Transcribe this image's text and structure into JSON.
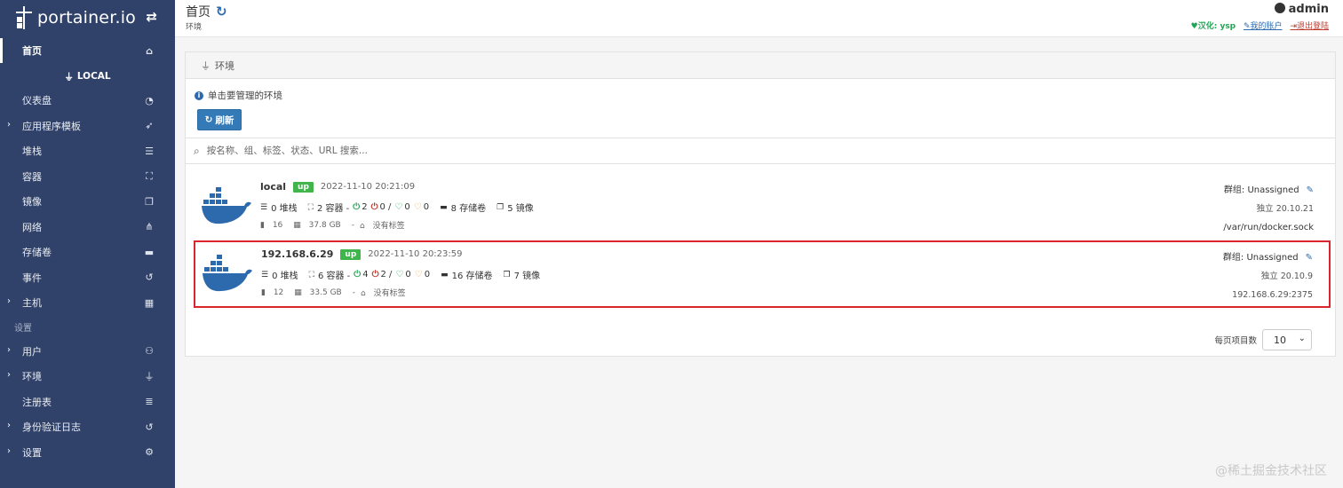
{
  "brand": {
    "name": "portainer.io",
    "toggle_icon": "exchange-icon"
  },
  "sidebar": {
    "home": {
      "label": "首页",
      "icon": "home-icon"
    },
    "env_header": "LOCAL",
    "items": [
      {
        "label": "仪表盘",
        "icon": "tachometer-icon",
        "chevron": false
      },
      {
        "label": "应用程序模板",
        "icon": "rocket-icon",
        "chevron": true
      },
      {
        "label": "堆栈",
        "icon": "th-list-icon",
        "chevron": false
      },
      {
        "label": "容器",
        "icon": "cubes-icon",
        "chevron": false
      },
      {
        "label": "镜像",
        "icon": "clone-icon",
        "chevron": false
      },
      {
        "label": "网络",
        "icon": "sitemap-icon",
        "chevron": false
      },
      {
        "label": "存储卷",
        "icon": "hdd-icon",
        "chevron": false
      },
      {
        "label": "事件",
        "icon": "history-icon",
        "chevron": false
      },
      {
        "label": "主机",
        "icon": "th-icon",
        "chevron": true
      }
    ],
    "settings_title": "设置",
    "settings_items": [
      {
        "label": "用户",
        "icon": "users-icon",
        "chevron": true
      },
      {
        "label": "环境",
        "icon": "plug-icon",
        "chevron": true
      },
      {
        "label": "注册表",
        "icon": "database-icon",
        "chevron": false
      },
      {
        "label": "身份验证日志",
        "icon": "history-icon",
        "chevron": true
      },
      {
        "label": "设置",
        "icon": "cogs-icon",
        "chevron": true
      }
    ]
  },
  "header": {
    "title": "首页",
    "breadcrumb": "环境",
    "user": "admin",
    "credit": "汉化: ysp",
    "my_account": "我的账户",
    "logout": "退出登陆"
  },
  "panel": {
    "title": "环境",
    "info": "单击要管理的环境",
    "refresh_label": "刷新",
    "search_placeholder": "按名称、组、标签、状态、URL 搜索..."
  },
  "environments": [
    {
      "name": "local",
      "status": "up",
      "time": "2022-11-10 20:21:09",
      "stacks": "0 堆栈",
      "containers": "2 容器 -",
      "running": "2",
      "stopped": "0 /",
      "healthy": "0",
      "unhealthy": "0",
      "volumes": "8 存储卷",
      "images": "5 镜像",
      "cpu": "16",
      "memory": "37.8 GB",
      "sep": "-",
      "tags": "没有标签",
      "group": "群组: Unassigned",
      "version": "独立 20.10.21",
      "url": "/var/run/docker.sock"
    },
    {
      "name": "192.168.6.29",
      "status": "up",
      "time": "2022-11-10 20:23:59",
      "stacks": "0 堆栈",
      "containers": "6 容器 -",
      "running": "4",
      "stopped": "2 /",
      "healthy": "0",
      "unhealthy": "0",
      "volumes": "16 存储卷",
      "images": "7 镜像",
      "cpu": "12",
      "memory": "33.5 GB",
      "sep": "-",
      "tags": "没有标签",
      "group": "群组: Unassigned",
      "version": "独立 20.10.9",
      "url": "192.168.6.29:2375"
    }
  ],
  "pagination": {
    "label": "每页项目数",
    "value": "10"
  },
  "watermark": "@稀土掘金技术社区",
  "colors": {
    "sidebar": "#30426a",
    "primary": "#337ab7",
    "up": "#3fb54b",
    "highlight": "#d9262e"
  }
}
